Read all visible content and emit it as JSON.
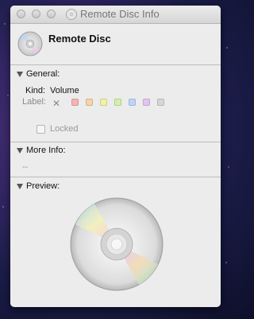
{
  "window": {
    "title": "Remote Disc Info",
    "disc_name": "Remote Disc"
  },
  "general": {
    "section_title": "General:",
    "kind_label": "Kind:",
    "kind_value": "Volume",
    "label_label": "Label:",
    "label_colors": [
      "#f7b3b3",
      "#f7d3a8",
      "#f2f2a6",
      "#d2f2a9",
      "#bfd5f7",
      "#e4c3f0",
      "#d6d6d6"
    ],
    "locked_label": "Locked",
    "locked_checked": false
  },
  "more_info": {
    "section_title": "More Info:",
    "value": "--"
  },
  "preview": {
    "section_title": "Preview:"
  },
  "icons": {
    "disc": "disc-icon",
    "clear_label": "x-icon",
    "disclosure": "disclosure-triangle-icon"
  }
}
